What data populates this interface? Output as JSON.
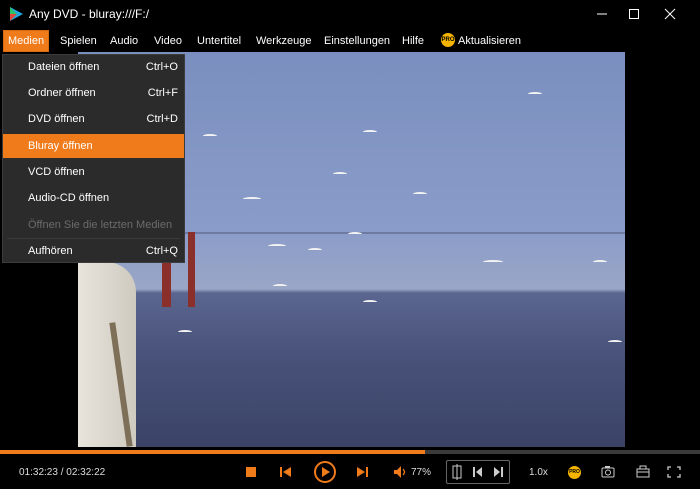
{
  "window": {
    "title": "Any DVD - bluray:///F:/"
  },
  "menubar": {
    "items": [
      {
        "label": "Medien"
      },
      {
        "label": "Spielen"
      },
      {
        "label": "Audio"
      },
      {
        "label": "Video"
      },
      {
        "label": "Untertitel"
      },
      {
        "label": "Werkzeuge"
      },
      {
        "label": "Einstellungen"
      },
      {
        "label": "Hilfe"
      },
      {
        "label": "Aktualisieren"
      }
    ],
    "pro_badge": "PRO"
  },
  "media_menu": {
    "items": [
      {
        "label": "Dateien öffnen",
        "shortcut": "Ctrl+O"
      },
      {
        "label": "Ordner öffnen",
        "shortcut": "Ctrl+F"
      },
      {
        "label": "DVD öffnen",
        "shortcut": "Ctrl+D"
      },
      {
        "label": "Bluray öffnen",
        "shortcut": ""
      },
      {
        "label": "VCD öffnen",
        "shortcut": ""
      },
      {
        "label": "Audio-CD öffnen",
        "shortcut": ""
      },
      {
        "label": "Öffnen Sie die letzten Medien",
        "shortcut": ""
      },
      {
        "label": "Aufhören",
        "shortcut": "Ctrl+Q"
      }
    ]
  },
  "playback": {
    "time_display": "01:32:23 / 02:32:22",
    "progress_fraction": 0.607,
    "volume": "77%",
    "speed": "1.0x",
    "pro_badge": "PRO"
  },
  "colors": {
    "accent": "#f07b1a",
    "menu_bg": "#2b2b2b",
    "background": "#000000"
  },
  "icons": [
    "app-logo",
    "minimize-icon",
    "maximize-icon",
    "close-icon",
    "stop-icon",
    "previous-icon",
    "play-icon",
    "next-icon",
    "volume-icon",
    "ab-loop-icon",
    "screenshot-icon",
    "toolbox-icon",
    "fullscreen-icon"
  ]
}
